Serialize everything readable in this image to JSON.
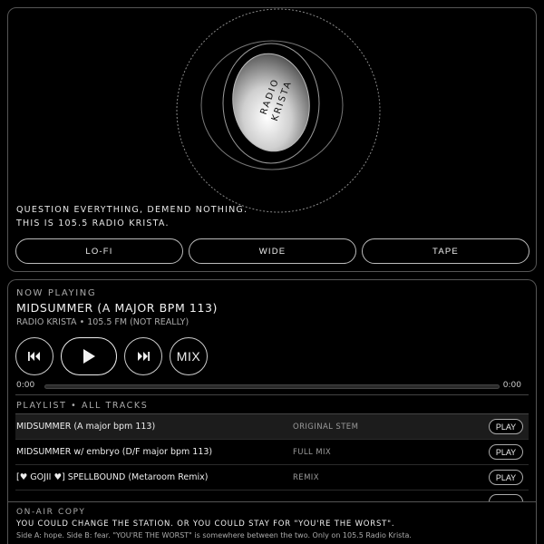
{
  "logo": {
    "text_line1": "RADIO",
    "text_line2": "KRISTA"
  },
  "tagline": {
    "line1": "QUESTION EVERYTHING, DEMEND NOTHING.",
    "line2": "THIS IS 105.5 RADIO KRISTA."
  },
  "modes": [
    {
      "label": "LO-FI"
    },
    {
      "label": "WIDE"
    },
    {
      "label": "TAPE"
    }
  ],
  "now_playing": {
    "label": "NOW PLAYING",
    "title": "MIDSUMMER (A MAJOR BPM 113)",
    "subtitle": "RADIO KRISTA • 105.5 FM (NOT REALLY)",
    "mix_label": "MIX",
    "current_time": "0:00",
    "duration": "0:00",
    "progress": 0
  },
  "playlist": {
    "label": "PLAYLIST • ALL TRACKS",
    "play_label": "PLAY",
    "tracks": [
      {
        "title": "MIDSUMMER (A major bpm 113)",
        "tag": "ORIGINAL STEM"
      },
      {
        "title": "MIDSUMMER w/ embryo (D/F major bpm 113)",
        "tag": "FULL MIX"
      },
      {
        "title": "[♥ GOJII ♥] SPELLBOUND (Metaroom Remix)",
        "tag": "REMIX"
      }
    ]
  },
  "onair": {
    "label": "ON-AIR COPY",
    "headline": "YOU COULD CHANGE THE STATION. OR YOU COULD STAY FOR \"YOU'RE THE WORST\".",
    "body": "Side A: hope. Side B: fear. \"YOU'RE THE WORST\" is somewhere between the two. Only on 105.5 Radio Krista."
  },
  "colors": {
    "background": "#000000",
    "border": "#555555",
    "text": "#e8e8e8",
    "muted": "#aaaaaa"
  }
}
